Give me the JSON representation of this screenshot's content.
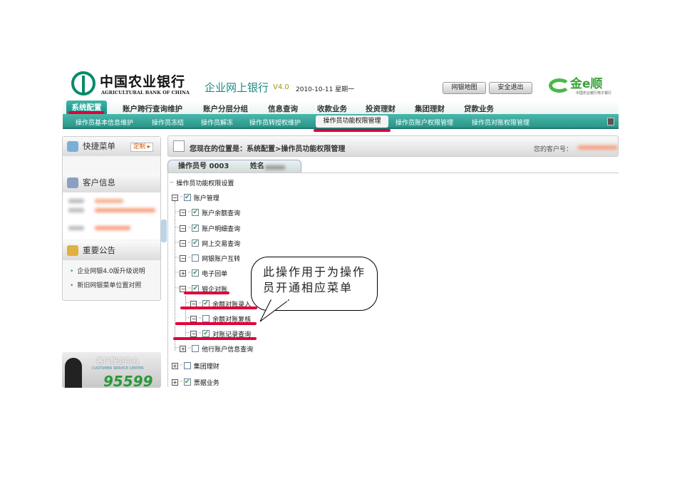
{
  "header": {
    "bank_name_cn": "中国农业银行",
    "bank_name_en": "AGRICULTURAL BANK OF CHINA",
    "system_title": "企业网上银行",
    "version": "V4.0",
    "date": "2010-10-11 星期一",
    "site_map_button": "网银地图",
    "logout_button": "安全退出",
    "brand_logo": "金e顺",
    "brand_sub": "中国农业银行电子银行"
  },
  "nav": {
    "items": [
      "系统配置",
      "账户跨行查询维护",
      "账户分层分组",
      "信息查询",
      "收款业务",
      "投资理财",
      "集团理财",
      "贷款业务"
    ]
  },
  "subnav": {
    "items": [
      "操作员基本信息维护",
      "操作员冻结",
      "操作员解冻",
      "操作员转授权维护",
      "操作员功能权限管理",
      "操作员账户权限管理",
      "操作员对账权限管理"
    ]
  },
  "sidebar": {
    "quick_menu": "快捷菜单",
    "customize_button": "定制 ▸",
    "customer_info": "客户信息",
    "notices_title": "重要公告",
    "notices": [
      "企业网银4.0版升级说明",
      "新旧网银菜单位置对照"
    ],
    "service_title": "客户服务中心",
    "service_en": "CUSTOMER SERVICE CENTER",
    "service_phone": "95599"
  },
  "main": {
    "breadcrumb": "您现在的位置是：系统配置>操作员功能权限管理",
    "customer_no_label": "您的客户号：",
    "tab_operator": "操作员号  0003",
    "tab_name_label": "姓名",
    "tree_title": "操作员功能权限设置",
    "tree": [
      {
        "label": "账户管理",
        "checked": true,
        "expander": "⊟"
      },
      {
        "label": "账户余额查询",
        "checked": true,
        "expander": "⊟"
      },
      {
        "label": "账户明细查询",
        "checked": true,
        "expander": "⊟"
      },
      {
        "label": "网上交易查询",
        "checked": true,
        "expander": "⊟"
      },
      {
        "label": "网银账户互转",
        "checked": false,
        "expander": "⊟"
      },
      {
        "label": "电子回单",
        "checked": true,
        "expander": "⊞"
      },
      {
        "label": "银企对账",
        "checked": true,
        "expander": "⊟"
      },
      {
        "label": "余额对账录入",
        "checked": true,
        "expander": "⊟"
      },
      {
        "label": "余额对账复核",
        "checked": false,
        "expander": "⊟"
      },
      {
        "label": "对账记录查询",
        "checked": true,
        "expander": "⊟"
      },
      {
        "label": "他行账户信息查询",
        "checked": false,
        "expander": "⊞"
      },
      {
        "label": "集团理财",
        "checked": false,
        "expander": "⊞"
      },
      {
        "label": "票据业务",
        "checked": true,
        "expander": "⊞"
      }
    ]
  },
  "callout": {
    "text": "此操作用于为操作员开通相应菜单"
  }
}
